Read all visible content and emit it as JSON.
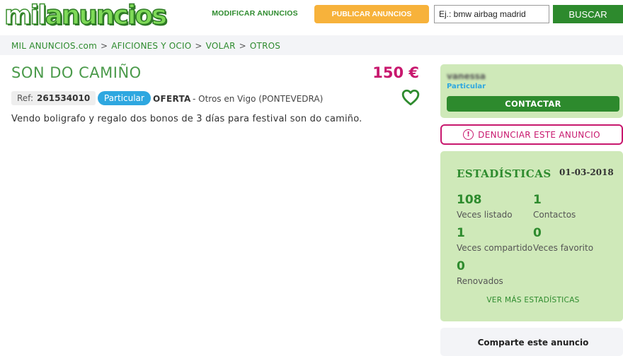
{
  "header": {
    "logo_part1": "mil",
    "logo_part2": "anuncios",
    "modificar_label": "MODIFICAR ANUNCIOS",
    "publicar_label": "PUBLICAR ANUNCIOS",
    "search_placeholder": "Ej.: bmw airbag madrid",
    "buscar_label": "BUSCAR"
  },
  "breadcrumb": [
    "MIL ANUNCIOS",
    ".com",
    "AFICIONES Y OCIO",
    "VOLAR",
    "OTROS"
  ],
  "breadcrumb_sep": ">",
  "ad": {
    "title": "SON DO CAMIÑO",
    "price": "150 €",
    "ref_label": "Ref:",
    "ref_value": "261534010",
    "seller_type_badge": "Particular",
    "kind": "OFERTA",
    "location": "- Otros en Vigo (PONTEVEDRA)",
    "description": "Vendo boligrafo y regalo dos bonos de 3 días para festival son do camiño."
  },
  "seller": {
    "name": "vanessa",
    "type": "Particular",
    "contact_label": "CONTACTAR"
  },
  "report": {
    "icon": "!",
    "label": "DENUNCIAR ESTE ANUNCIO"
  },
  "stats": {
    "title": "ESTADÍSTICAS",
    "date": "01-03-2018",
    "listed_value": "108",
    "listed_label": "Veces listado",
    "contacts_value": "1",
    "contacts_label": "Contactos",
    "shared_value": "1",
    "shared_label": "Veces compartido",
    "favorite_value": "0",
    "favorite_label": "Veces favorito",
    "renewed_value": "0",
    "renewed_label": "Renovados",
    "more_label": "VER MÁS ESTADÍSTICAS"
  },
  "share": {
    "title": "Comparte este anuncio"
  },
  "colors": {
    "brand_green": "#2d8a2d",
    "light_green": "#cfe9b9",
    "publish_orange": "#f7b23b",
    "price_magenta": "#c8186e",
    "badge_blue": "#2ea7e0"
  }
}
